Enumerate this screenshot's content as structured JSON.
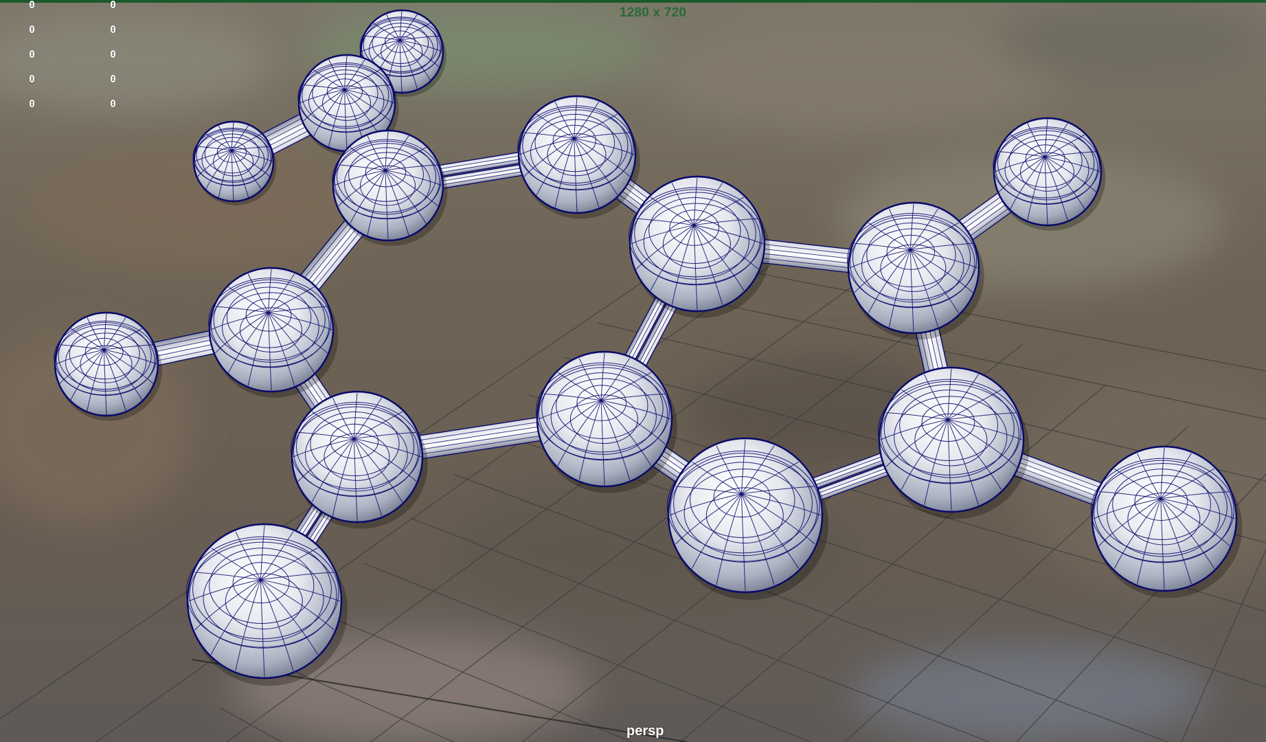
{
  "viewport": {
    "resolution_gate_label": "1280 x 720",
    "camera_name": "persp"
  },
  "hud": {
    "left_column": [
      "0",
      "0",
      "0",
      "0",
      "0"
    ],
    "right_column": [
      "0",
      "0",
      "0",
      "0",
      "0"
    ]
  },
  "scene": {
    "object_type": "molecule-ball-and-stick",
    "wireframe_color": "#0a0a6a",
    "sphere_shade_light": "#ffffff",
    "sphere_shade_dark": "#7f8aa0",
    "grid_color": "#3c3c3c",
    "background_tone": "#6b6257",
    "top_border_color": "#1a5a2a",
    "resolution_label_color": "#2a6a35"
  }
}
